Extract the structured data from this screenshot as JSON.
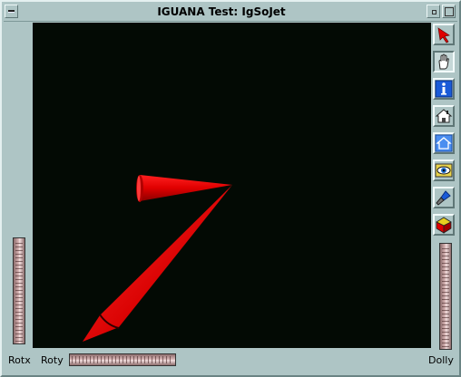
{
  "window": {
    "title": "IGUANA Test: IgSoJet"
  },
  "toolbar": {
    "tools": [
      {
        "name": "select-arrow",
        "icon": "pointer-arrow-icon"
      },
      {
        "name": "view-hand",
        "icon": "hand-icon"
      },
      {
        "name": "info",
        "icon": "info-icon"
      },
      {
        "name": "home",
        "icon": "home-icon"
      },
      {
        "name": "set-home",
        "icon": "set-home-icon"
      },
      {
        "name": "view-all",
        "icon": "eye-icon"
      },
      {
        "name": "seek",
        "icon": "flashlight-icon"
      },
      {
        "name": "projection",
        "icon": "cube-icon"
      }
    ]
  },
  "wheels": {
    "rotx_label": "Rotx",
    "roty_label": "Roty",
    "dolly_label": "Dolly"
  },
  "colors": {
    "viewport_bg": "#030a04",
    "jet_red": "#e00000",
    "frame": "#aec5c5"
  }
}
